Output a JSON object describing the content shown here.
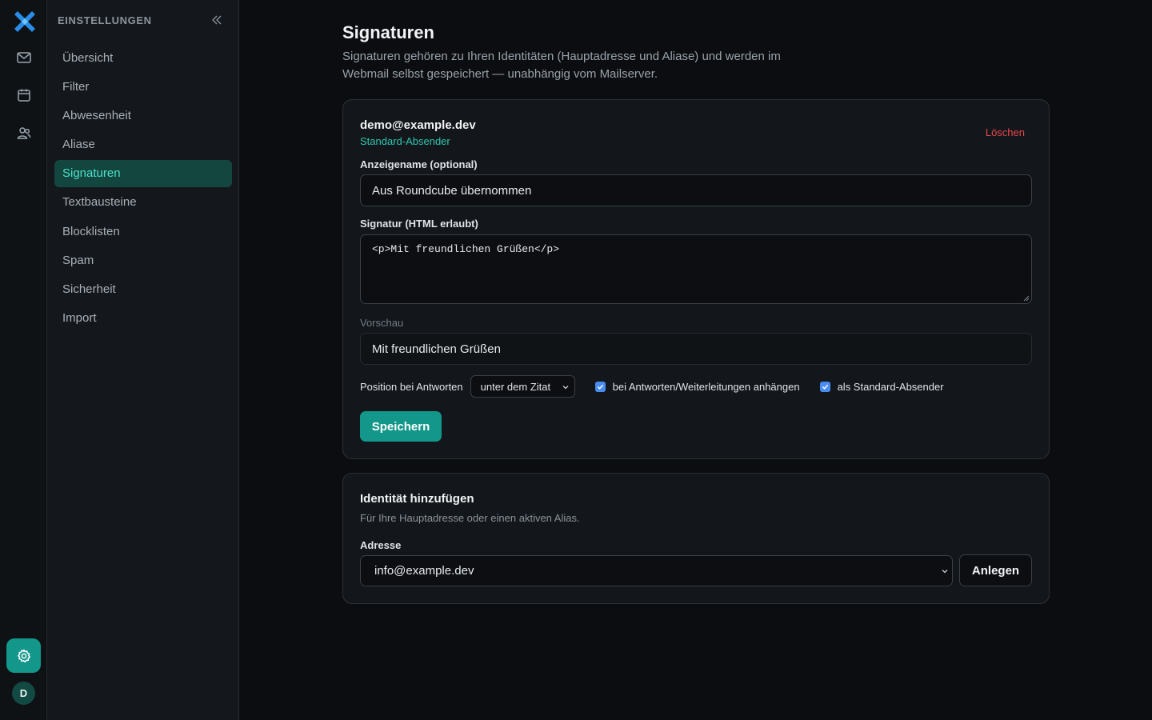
{
  "sidebar": {
    "title": "EINSTELLUNGEN",
    "items": [
      {
        "label": "Übersicht"
      },
      {
        "label": "Filter"
      },
      {
        "label": "Abwesenheit"
      },
      {
        "label": "Aliase"
      },
      {
        "label": "Signaturen",
        "active": true
      },
      {
        "label": "Textbausteine"
      },
      {
        "label": "Blocklisten"
      },
      {
        "label": "Spam"
      },
      {
        "label": "Sicherheit"
      },
      {
        "label": "Import"
      }
    ]
  },
  "rail": {
    "icons": [
      "logo",
      "mail-icon",
      "calendar-icon",
      "contacts-icon",
      "gear-icon"
    ],
    "avatar_initial": "D"
  },
  "page": {
    "title": "Signaturen",
    "description": "Signaturen gehören zu Ihren Identitäten (Hauptadresse und Aliase) und werden im Webmail selbst gespeichert — unabhängig vom Mailserver."
  },
  "identity": {
    "email": "demo@example.dev",
    "badge": "Standard-Absender",
    "delete_label": "Löschen",
    "display_name_label": "Anzeigename (optional)",
    "display_name_value": "Aus Roundcube übernommen",
    "signature_label": "Signatur (HTML erlaubt)",
    "signature_value": "<p>Mit freundlichen Grüßen</p>",
    "preview_label": "Vorschau",
    "preview_value": "Mit freundlichen Grüßen",
    "position_label": "Position bei Antworten",
    "position_value": "unter dem Zitat",
    "attach_label": "bei Antworten/Weiterleitungen anhängen",
    "attach_checked": true,
    "default_label": "als Standard-Absender",
    "default_checked": true,
    "save_label": "Speichern"
  },
  "add_identity": {
    "title": "Identität hinzufügen",
    "description": "Für Ihre Hauptadresse oder einen aktiven Alias.",
    "address_label": "Adresse",
    "address_value": "info@example.dev",
    "create_label": "Anlegen"
  },
  "colors": {
    "accent": "#12978a",
    "accent_text": "#2fc7ae",
    "danger": "#e5484d",
    "checkbox": "#4a8df0"
  }
}
